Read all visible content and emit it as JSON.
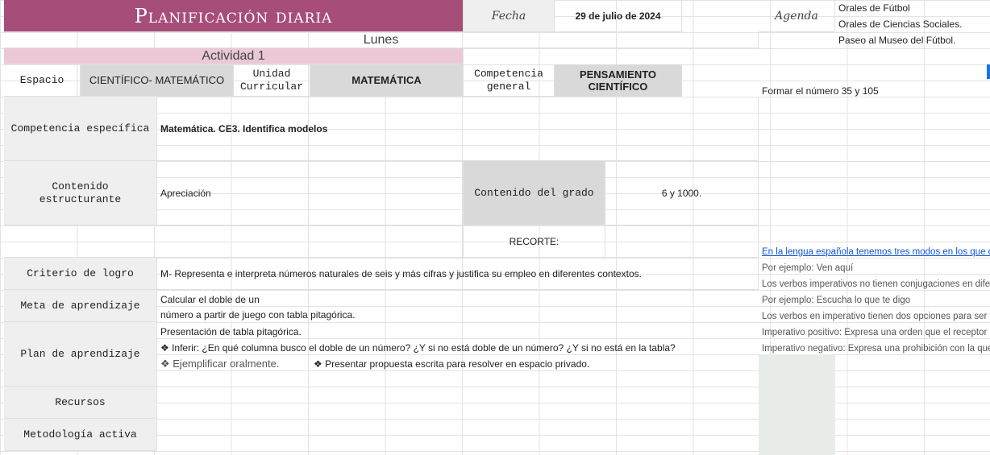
{
  "header": {
    "title": "Planificación diaria",
    "fecha_label": "Fecha",
    "fecha_value": "29 de julio de 2024",
    "day": "Lunes",
    "activity": "Actividad 1",
    "agenda_label": "Agenda",
    "agenda_items": [
      "Orales de Fútbol",
      "Orales de Ciencias Sociales.",
      "Paseo al Museo del Fútbol."
    ]
  },
  "row_espacio": {
    "espacio_label": "Espacio",
    "espacio_value": "CIENTÍFICO- MATEMÁTICO",
    "unidad_label": "Unidad\nCurricular",
    "unidad_value": "MATEMÁTICA",
    "competencia_label": "Competencia\ngeneral",
    "competencia_value": "PENSAMIENTO\nCIENTÍFICO"
  },
  "side_note": "Formar el número 35 y 105",
  "competencia_especifica": {
    "label": "Competencia específica",
    "value": "Matemática. CE3. Identifica modelos"
  },
  "contenido": {
    "label": "Contenido\nestructurante",
    "value": "Apreciación",
    "grado_label": "Contenido del grado",
    "grado_value": "6 y 1000."
  },
  "recorte_label": "RECORTE:",
  "criterio": {
    "label": "Criterio de logro",
    "value": "M- Representa e interpreta números naturales de seis y más cifras y justifica su empleo en diferentes contextos."
  },
  "meta": {
    "label": "Meta de aprendizaje",
    "line1": "Calcular el doble de un",
    "line2": "número a partir de juego con tabla pitagórica."
  },
  "plan": {
    "label": "Plan de aprendizaje",
    "line1": "Presentación de tabla pitagórica.",
    "line2": "❖ Inferir: ¿En qué columna busco el doble de un número? ¿Y si no está doble de un número? ¿Y si no está en la tabla?",
    "line3a": "❖ Ejemplificar oralmente.",
    "line3b": "❖ Presentar propuesta escrita para resolver en espacio privado."
  },
  "recursos_label": "Recursos",
  "metodologia_label": "Metodología activa",
  "grammar_notes": [
    "En la lengua española tenemos tres modos en los que conjugar los verbos",
    "Por ejemplo: Ven aquí",
    "Los verbos imperativos no tienen conjugaciones en diferentes tiempos",
    "Por ejemplo: Escucha lo que te digo",
    "Los verbos en imperativo tienen dos opciones para ser formados",
    "Imperativo positivo: Expresa una orden que el receptor debe cumplir",
    "Imperativo negativo: Expresa una prohibición con la que el receptor no debe cumplir"
  ],
  "colors": {
    "magenta": "#a64d79",
    "pink": "#eac8d6",
    "gray": "#d9d9d9",
    "link": "#1155cc"
  }
}
